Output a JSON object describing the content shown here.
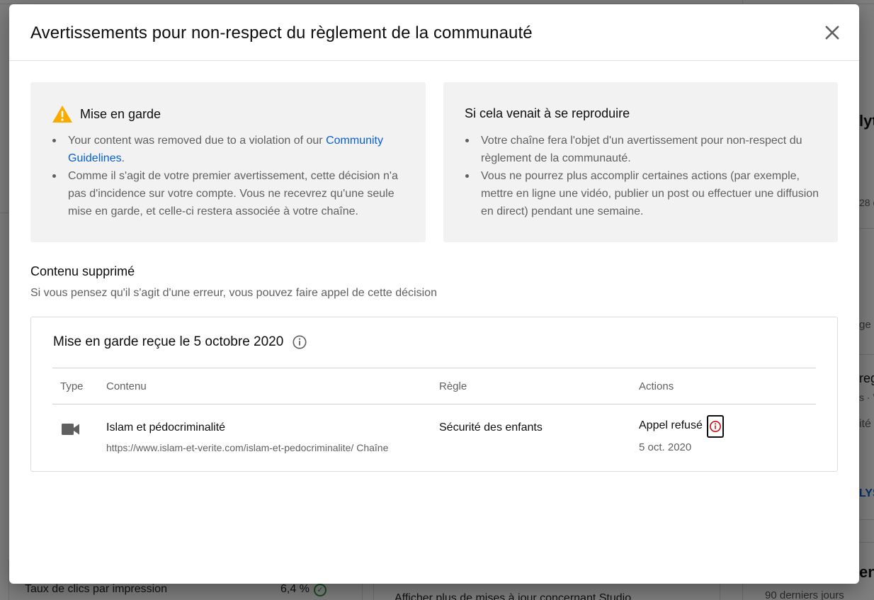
{
  "background": {
    "ctr_label": "Taux de clics par impression",
    "ctr_value": "6,4 %",
    "studio_updates": "Afficher plus de mises à jour concernant Studio",
    "right_fragments": [
      "lyt",
      "28 c",
      "ge (",
      "reg",
      "s · V",
      "ité",
      "LYS",
      "ent"
    ],
    "right_sub": "90 derniers jours"
  },
  "dialog": {
    "title": "Avertissements pour non-respect du règlement de la communauté",
    "close_icon": "close-icon"
  },
  "warning_panel": {
    "heading": "Mise en garde",
    "icon": "warning-icon",
    "bullet1_text": "Your content was removed due to a violation of our ",
    "bullet1_link": "Community Guidelines",
    "bullet1_end": ".",
    "bullet2": "Comme il s'agit de votre premier avertissement, cette décision n'a pas d'incidence sur votre compte. Vous ne recevrez qu'une seule mise en garde, et celle-ci restera associée à votre chaîne."
  },
  "repeat_panel": {
    "heading": "Si cela venait à se reproduire",
    "bullets": [
      "Votre chaîne fera l'objet d'un avertissement pour non-respect du règlement de la communauté.",
      "Vous ne pourrez plus accomplir certaines actions (par exemple, mettre en ligne une vidéo, publier un post ou effectuer une diffusion en direct) pendant une semaine."
    ]
  },
  "removed_content": {
    "title": "Contenu supprimé",
    "subtitle": "Si vous pensez qu'il s'agit d'une erreur, vous pouvez faire appel de cette décision"
  },
  "strike": {
    "heading": "Mise en garde reçue le 5 octobre 2020",
    "columns": {
      "type": "Type",
      "content": "Contenu",
      "rule": "Règle",
      "actions": "Actions"
    },
    "row": {
      "type_icon": "video-camera-icon",
      "content_title": "Islam et pédocriminalité",
      "content_url": "https://www.islam-et-verite.com/islam-et-pedocriminalite/ Chaîne",
      "rule": "Sécurité des enfants",
      "action_status": "Appel refusé",
      "action_date": "5 oct. 2020"
    }
  },
  "colors": {
    "link": "#065fd4",
    "warning": "#f9ab00",
    "error": "#cc0000",
    "panel_bg": "#f2f2f2"
  }
}
